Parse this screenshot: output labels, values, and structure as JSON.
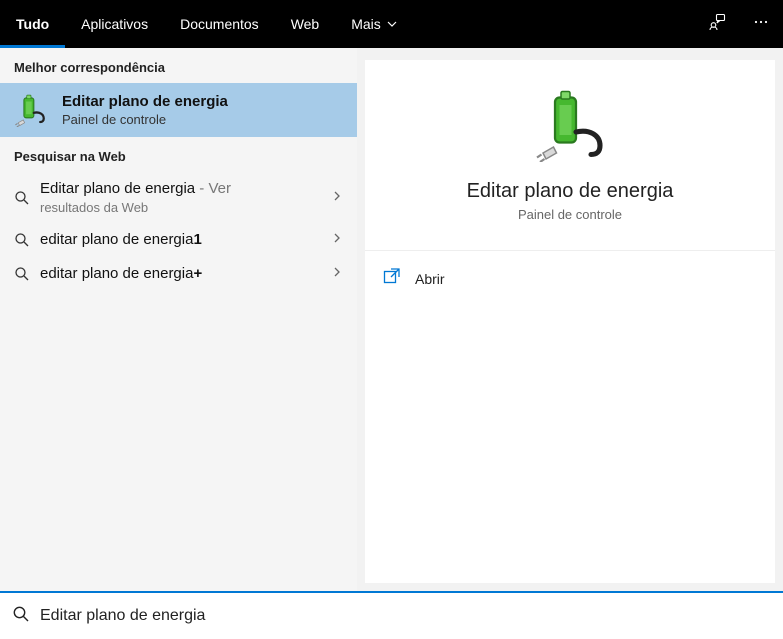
{
  "topbar": {
    "tabs": [
      {
        "label": "Tudo",
        "active": true
      },
      {
        "label": "Aplicativos",
        "active": false
      },
      {
        "label": "Documentos",
        "active": false
      },
      {
        "label": "Web",
        "active": false
      },
      {
        "label": "Mais",
        "active": false,
        "dropdown": true
      }
    ]
  },
  "left": {
    "best_match_header": "Melhor correspondência",
    "best_match": {
      "title": "Editar plano de energia",
      "subtitle": "Painel de controle"
    },
    "web_header": "Pesquisar na Web",
    "web_items": [
      {
        "primary": "Editar plano de energia",
        "secondary": " - Ver",
        "sub": "resultados da Web"
      },
      {
        "primary": "editar plano de energia",
        "secondary": "1",
        "bold_secondary": true
      },
      {
        "primary": "editar plano de energia",
        "secondary": "+",
        "bold_secondary": true
      }
    ]
  },
  "detail": {
    "title": "Editar plano de energia",
    "subtitle": "Painel de controle",
    "actions": [
      {
        "label": "Abrir",
        "icon": "open-icon"
      }
    ]
  },
  "search": {
    "value": "Editar plano de energia"
  },
  "colors": {
    "accent": "#0078d4",
    "selected_bg": "#a6cbe8",
    "battery_green": "#3fa82f",
    "battery_dark": "#2a7a1f"
  }
}
